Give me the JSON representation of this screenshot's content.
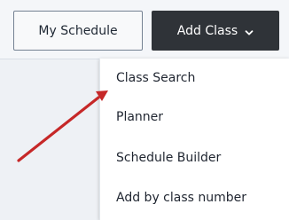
{
  "toolbar": {
    "my_schedule_label": "My Schedule",
    "add_class_label": "Add Class",
    "add_class_icon": "chevron-down-icon"
  },
  "dropdown": {
    "items": [
      {
        "label": "Class Search"
      },
      {
        "label": "Planner"
      },
      {
        "label": "Schedule Builder"
      },
      {
        "label": "Add by class number"
      }
    ]
  },
  "annotation": {
    "arrow_color": "#c62828"
  },
  "colors": {
    "button_dark": "#2f3338",
    "button_light_border": "#748192",
    "page_background": "#eef1f5"
  }
}
